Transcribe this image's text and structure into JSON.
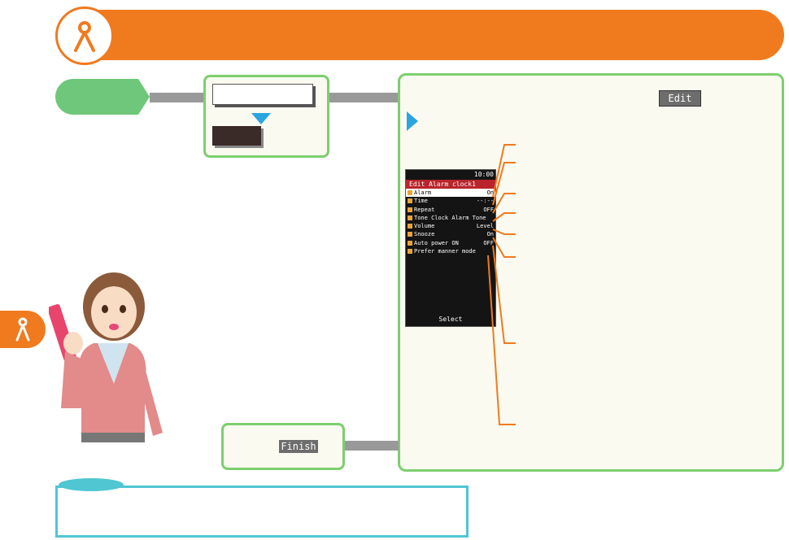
{
  "colors": {
    "accent": "#f07a1e",
    "green": "#6ec77a",
    "border_green": "#7ccf6e",
    "blue": "#2aa5e0",
    "cyan": "#4fc6d2"
  },
  "icons": {
    "section": "wrench-tool-icon",
    "side_tab": "wrench-tool-icon"
  },
  "buttons": {
    "edit": "Edit",
    "finish": "Finish"
  },
  "phone": {
    "status_time": "10:00",
    "title": "Edit Alarm clock1",
    "rows": [
      {
        "label": "Alarm",
        "value": "On"
      },
      {
        "label": "Time",
        "value": "--:--"
      },
      {
        "label": "Repeat",
        "value": "OFF"
      },
      {
        "label": "Tone",
        "value": "Clock Alarm Tone"
      },
      {
        "label": "Volume",
        "value": "Level"
      },
      {
        "label": "Snooze",
        "value": "On"
      },
      {
        "label": "Auto power ON",
        "value": "OFF"
      },
      {
        "label": "Prefer manner mode",
        "value": ""
      }
    ],
    "softkey": "Select"
  }
}
